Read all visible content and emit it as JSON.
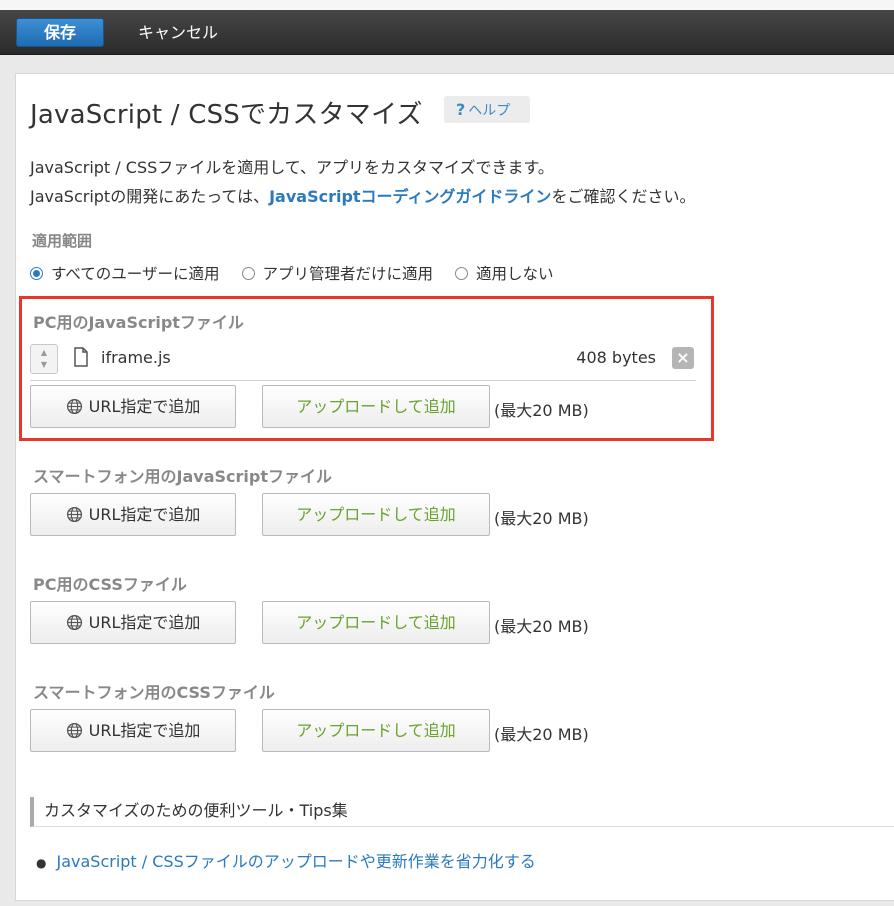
{
  "toolbar": {
    "save_label": "保存",
    "cancel_label": "キャンセル"
  },
  "page": {
    "title": "JavaScript / CSSでカスタマイズ",
    "help_label": "ヘルプ",
    "description_line1": "JavaScript / CSSファイルを適用して、アプリをカスタマイズできます。",
    "description_line2_prefix": "JavaScriptの開発にあたっては、",
    "description_line2_link": "JavaScriptコーディングガイドライン",
    "description_line2_suffix": "をご確認ください。"
  },
  "scope": {
    "label": "適用範囲",
    "options": [
      "すべてのユーザーに適用",
      "アプリ管理者だけに適用",
      "適用しない"
    ],
    "selected_index": 0
  },
  "groups": [
    {
      "title": "PC用のJavaScriptファイル",
      "files": [
        {
          "name": "iframe.js",
          "size": "408 bytes"
        }
      ],
      "url_button": "URL指定で追加",
      "upload_button": "アップロードして追加",
      "max_size": "(最大20 MB)"
    },
    {
      "title": "スマートフォン用のJavaScriptファイル",
      "url_button": "URL指定で追加",
      "upload_button": "アップロードして追加",
      "max_size": "(最大20 MB)"
    },
    {
      "title": "PC用のCSSファイル",
      "url_button": "URL指定で追加",
      "upload_button": "アップロードして追加",
      "max_size": "(最大20 MB)"
    },
    {
      "title": "スマートフォン用のCSSファイル",
      "url_button": "URL指定で追加",
      "upload_button": "アップロードして追加",
      "max_size": "(最大20 MB)"
    }
  ],
  "tips": {
    "heading": "カスタマイズのための便利ツール・Tips集",
    "items": [
      "JavaScript / CSSファイルのアップロードや更新作業を省力化する"
    ]
  },
  "colors": {
    "accent_blue": "#2a7ac0",
    "save_button": "#1d6cb4",
    "upload_text": "#68a32d",
    "highlight_border": "#e8362a"
  }
}
